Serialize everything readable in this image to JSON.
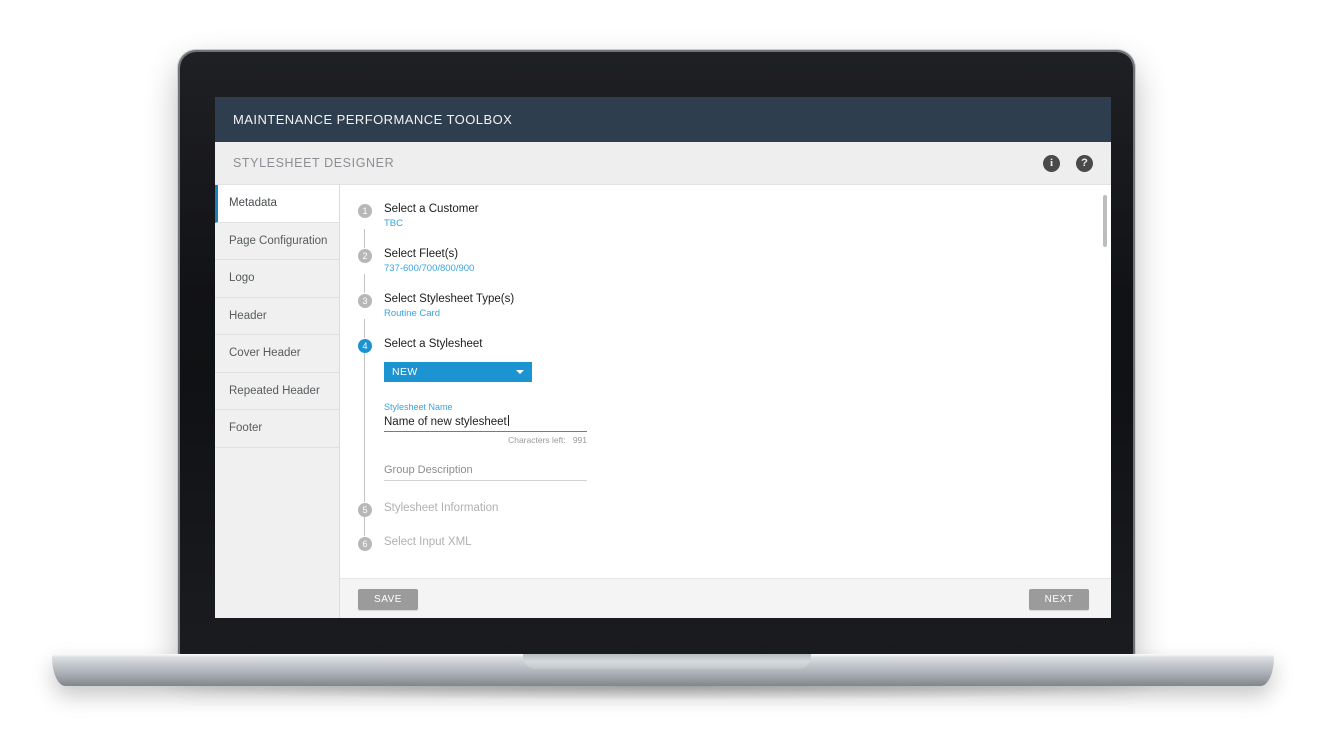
{
  "app": {
    "topbar_title": "MAINTENANCE PERFORMANCE TOOLBOX",
    "subbar_title": "STYLESHEET DESIGNER",
    "info_icon_glyph": "i",
    "help_icon_glyph": "?",
    "accent_blue": "#1d94d2",
    "topbar_bg": "#2f3e4f",
    "link_blue": "#3aa3dd"
  },
  "sidebar": {
    "items": [
      {
        "label": "Metadata",
        "active": true
      },
      {
        "label": "Page Configuration",
        "active": false
      },
      {
        "label": "Logo",
        "active": false
      },
      {
        "label": "Header",
        "active": false
      },
      {
        "label": "Cover Header",
        "active": false
      },
      {
        "label": "Repeated Header",
        "active": false
      },
      {
        "label": "Footer",
        "active": false
      }
    ]
  },
  "steps": [
    {
      "number": "1",
      "title": "Select a Customer",
      "value": "TBC",
      "state": "done"
    },
    {
      "number": "2",
      "title": "Select Fleet(s)",
      "value": "737-600/700/800/900",
      "state": "done"
    },
    {
      "number": "3",
      "title": "Select Stylesheet Type(s)",
      "value": "Routine Card",
      "state": "done"
    },
    {
      "number": "4",
      "title": "Select a Stylesheet",
      "value": "",
      "state": "active"
    },
    {
      "number": "5",
      "title": "Stylesheet Information",
      "value": "",
      "state": "pending"
    },
    {
      "number": "6",
      "title": "Select Input XML",
      "value": "",
      "state": "pending"
    }
  ],
  "form": {
    "dropdown_value": "NEW",
    "dropdown_icon": "chevron-down-icon",
    "name_label": "Stylesheet Name",
    "name_value": "Name of new stylesheet",
    "characters_left_label": "Characters left:",
    "characters_left_count": "991",
    "description_placeholder": "Group Description"
  },
  "footer": {
    "save_label": "SAVE",
    "next_label": "NEXT"
  }
}
